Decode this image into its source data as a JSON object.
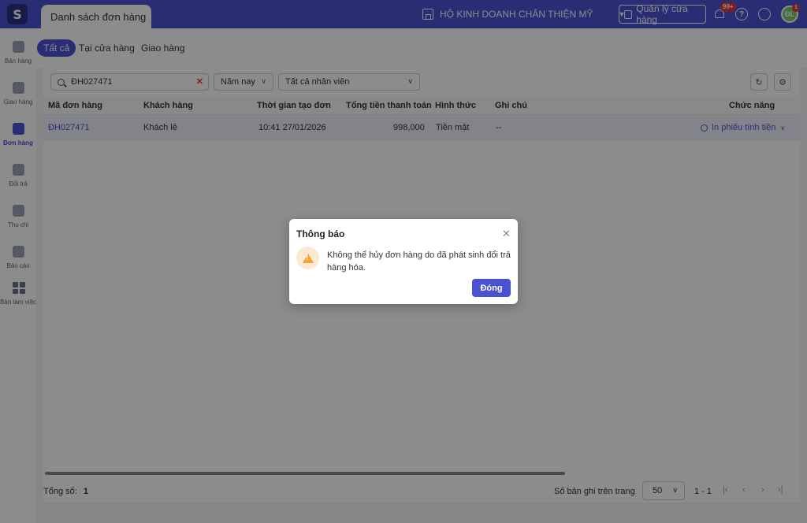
{
  "header": {
    "logo_text": "S",
    "main_tab": "Danh sách đơn hàng",
    "store_name": "HỘ KINH DOANH CHÂN THIỆN MỸ",
    "store_manage_button": "Quản lý cửa hàng",
    "notification_badge": "99+",
    "avatar_badge": "1",
    "avatar_text": "ĐL"
  },
  "sidebar": {
    "items": [
      {
        "label": "Bán hàng",
        "icon": "cart-icon",
        "active": false
      },
      {
        "label": "Giao hàng",
        "icon": "truck-icon",
        "active": false
      },
      {
        "label": "Đơn hàng",
        "icon": "order-icon",
        "active": true
      },
      {
        "label": "Đổi trả",
        "icon": "return-icon",
        "active": false
      },
      {
        "label": "Thu chi",
        "icon": "wallet-icon",
        "active": false
      },
      {
        "label": "Báo cáo",
        "icon": "report-icon",
        "active": false
      },
      {
        "label": "Bàn làm việc",
        "icon": "grid-icon",
        "active": false
      }
    ]
  },
  "subtabs": [
    "Tất cả",
    "Tại cửa hàng",
    "Giao hàng"
  ],
  "filters": {
    "search_value": "ĐH027471",
    "year": "Năm nay",
    "staff": "Tất cả nhân viên"
  },
  "table": {
    "columns": [
      "Mã đơn hàng",
      "Khách hàng",
      "Thời gian tạo đơn",
      "Tổng tiền thanh toán",
      "Hình thức",
      "Ghi chú",
      "Chức năng"
    ],
    "rows": [
      {
        "code": "ĐH027471",
        "customer": "Khách lẻ",
        "created": "10:41 27/01/2026",
        "total": "998,000",
        "method": "Tiền mặt",
        "note": "--",
        "action": "In phiếu tính tiền"
      }
    ]
  },
  "footer": {
    "total_label": "Tổng số:",
    "total_value": "1",
    "per_page_label": "Số bản ghi trên trang",
    "per_page_value": "50",
    "range": "1 - 1"
  },
  "dialog": {
    "title": "Thông báo",
    "message": "Không thể hủy đơn hàng do đã phát sinh đổi trả hàng hóa.",
    "button": "Đóng"
  },
  "colors": {
    "primary": "#4a52d4",
    "warning": "#f4a23a",
    "danger": "#e53935"
  }
}
